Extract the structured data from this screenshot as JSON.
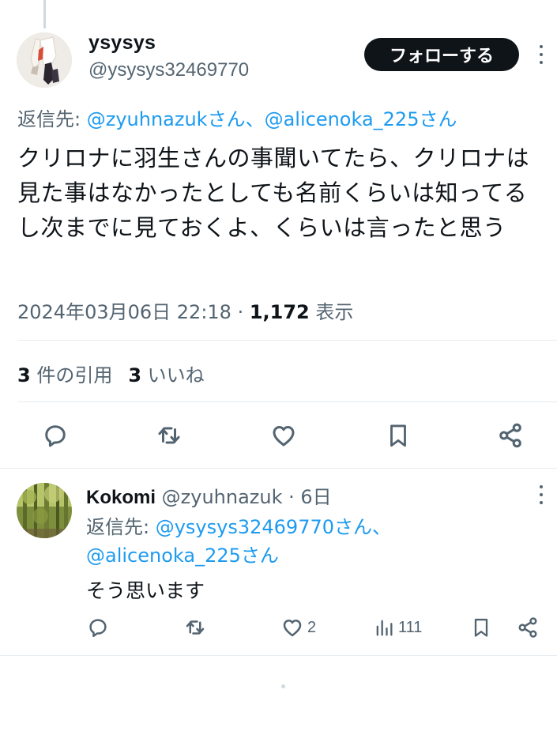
{
  "main_tweet": {
    "display_name": "ysysys",
    "handle": "@ysysys32469770",
    "follow_label": "フォローする",
    "reply_prefix": "返信先: ",
    "mentions": [
      "@zyuhnazukさん",
      "@alicenoka_225さん"
    ],
    "mention_separator": "、",
    "text": "クリロナに羽生さんの事聞いてたら、クリロナは見た事はなかったとしても名前くらいは知ってるし次までに見ておくよ、くらいは言ったと思う",
    "timestamp": "2024年03月06日 22:18",
    "separator": " · ",
    "views_count": "1,172",
    "views_label": " 表示",
    "quotes_count": "3",
    "quotes_label": " 件の引用",
    "likes_count": "3",
    "likes_label": " いいね",
    "actions": [
      "reply-icon",
      "retweet-icon",
      "like-icon",
      "bookmark-icon",
      "share-icon"
    ]
  },
  "reply_tweet": {
    "display_name": "Kokomi",
    "handle": "@zyuhnazuk",
    "time": " · 6日",
    "reply_prefix": "返信先: ",
    "mentions": [
      "@ysysys32469770さん、",
      "@alicenoka_225さん"
    ],
    "text": "そう思います",
    "like_count": "2",
    "view_count": "111",
    "actions": [
      "reply-icon",
      "retweet-icon",
      "like-icon",
      "views-icon",
      "bookmark-icon",
      "share-icon"
    ]
  },
  "colors": {
    "text": "#0f1419",
    "secondary": "#536471",
    "link": "#1d9bf0",
    "divider": "#e6ecf0"
  }
}
